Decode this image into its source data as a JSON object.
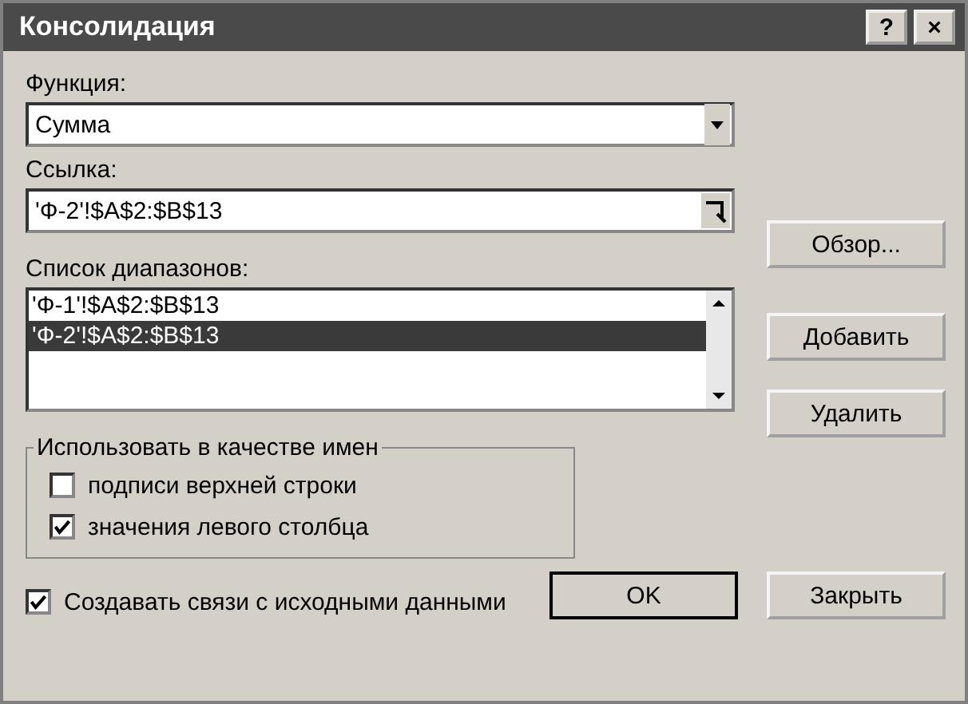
{
  "window": {
    "title": "Консолидация",
    "buttons": [
      "?",
      "×"
    ]
  },
  "function": {
    "label": "Функция:",
    "value": "Сумма"
  },
  "reference": {
    "label": "Ссылка:",
    "value": "'Ф-2'!$A$2:$B$13"
  },
  "browse_button": "Обзор...",
  "ranges": {
    "label": "Список диапазонов:",
    "items": [
      {
        "text": "'Ф-1'!$A$2:$B$13",
        "selected": false
      },
      {
        "text": "'Ф-2'!$A$2:$B$13",
        "selected": true
      }
    ]
  },
  "add_button": "Добавить",
  "delete_button": "Удалить",
  "use_labels": {
    "title": "Использовать в качестве имен",
    "options": [
      {
        "label": "подписи верхней строки",
        "checked": false
      },
      {
        "label": "значения левого столбца",
        "checked": true
      }
    ]
  },
  "create_links": {
    "label": "Создавать связи с исходными данными",
    "checked": true
  },
  "ok_button": "OK",
  "close_button": "Закрыть"
}
